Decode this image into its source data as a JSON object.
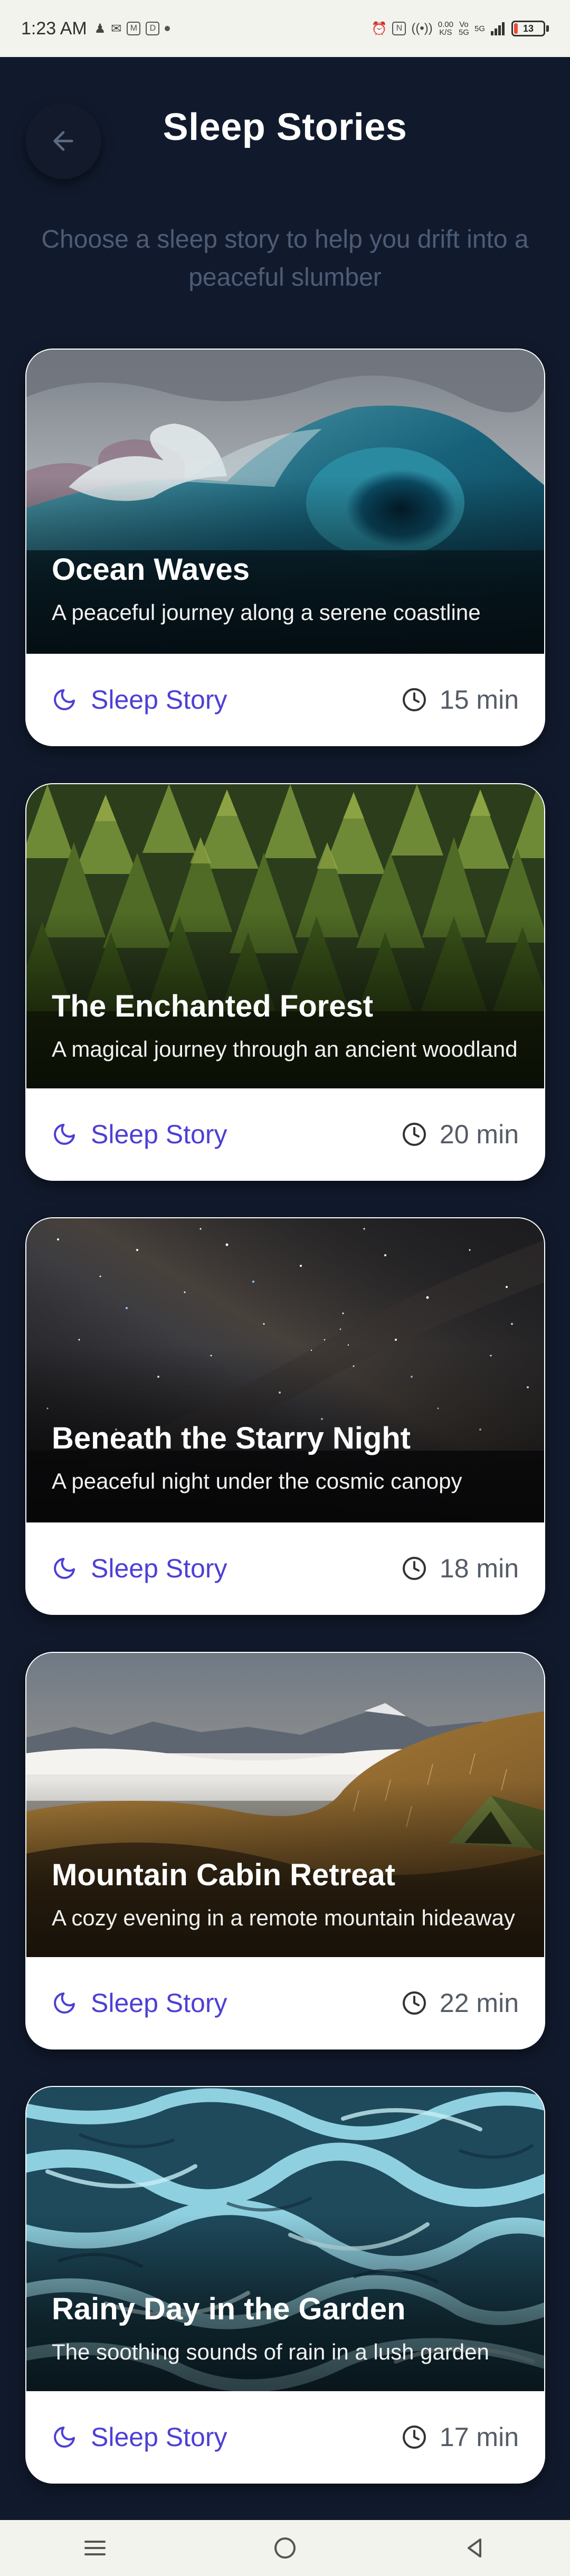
{
  "status_bar": {
    "time": "1:23 AM",
    "network_speed_value": "0.00",
    "network_speed_unit": "K/S",
    "sim1_label": "Vo",
    "sim1_sub": "5G",
    "sim2_label": "5G",
    "battery_level": "13",
    "battery_color": "#e84a3a"
  },
  "header": {
    "title": "Sleep Stories",
    "subtitle": "Choose a sleep story to help you drift into a peaceful slumber"
  },
  "accent_color": "#4d3fd6",
  "stories": [
    {
      "title": "Ocean Waves",
      "description": "A peaceful journey along a serene coastline",
      "tag": "Sleep Story",
      "duration": "15 min",
      "image": "ocean-wave"
    },
    {
      "title": "The Enchanted Forest",
      "description": "A magical journey through an ancient woodland",
      "tag": "Sleep Story",
      "duration": "20 min",
      "image": "pine-forest"
    },
    {
      "title": "Beneath the Starry Night",
      "description": "A peaceful night under the cosmic canopy",
      "tag": "Sleep Story",
      "duration": "18 min",
      "image": "starry-sky"
    },
    {
      "title": "Mountain Cabin Retreat",
      "description": "A cozy evening in a remote mountain hideaway",
      "tag": "Sleep Story",
      "duration": "22 min",
      "image": "mountain-tent"
    },
    {
      "title": "Rainy Day in the Garden",
      "description": "The soothing sounds of rain in a lush garden",
      "tag": "Sleep Story",
      "duration": "17 min",
      "image": "aerial-river"
    }
  ],
  "nav_bar": {
    "buttons": [
      "menu-icon",
      "home-icon",
      "back-icon"
    ]
  }
}
